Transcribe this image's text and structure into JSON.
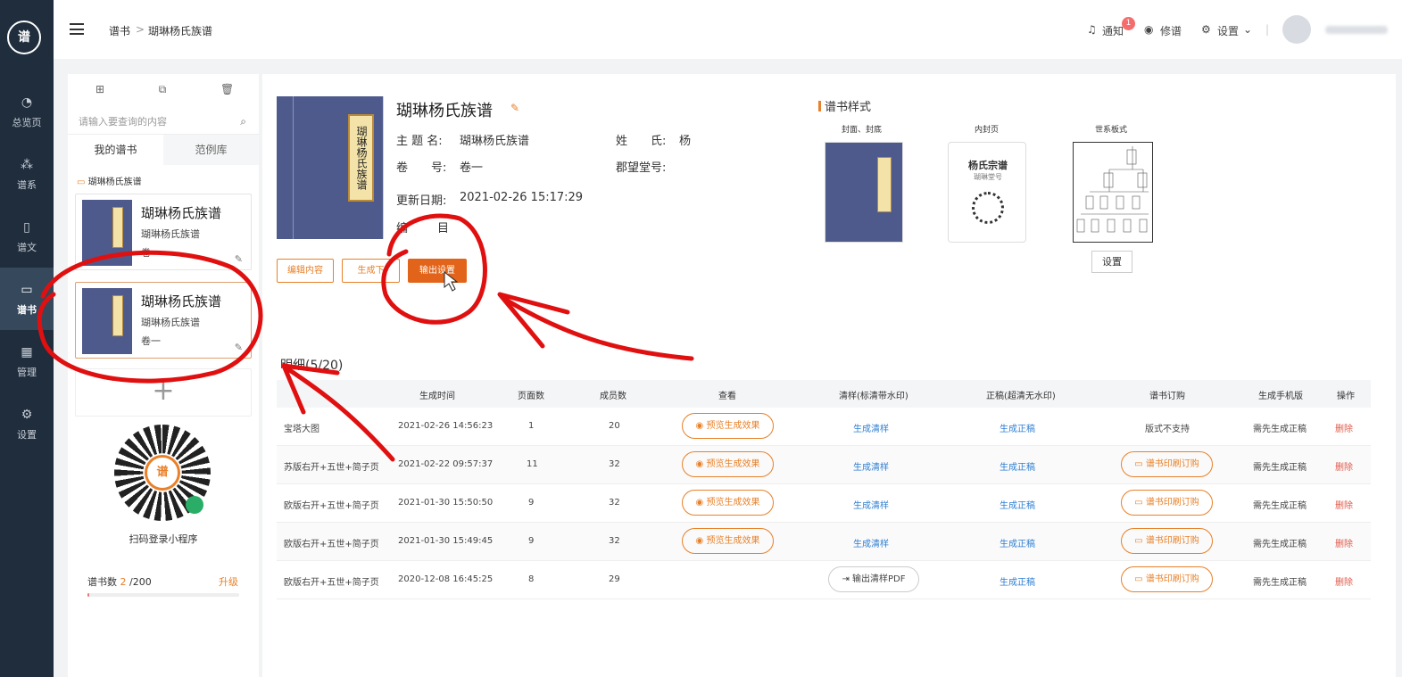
{
  "nav": [
    {
      "label": "总览页",
      "icon": "pie-chart-icon"
    },
    {
      "label": "谱系",
      "icon": "tree-icon"
    },
    {
      "label": "谱文",
      "icon": "document-icon"
    },
    {
      "label": "谱书",
      "icon": "book-icon"
    },
    {
      "label": "管理",
      "icon": "grid-icon"
    },
    {
      "label": "设置",
      "icon": "gear-icon"
    }
  ],
  "breadcrumb": {
    "root": "谱书",
    "sep": ">",
    "current": "瑚琳杨氏族谱"
  },
  "topbar": {
    "notify": "通知",
    "badge": "1",
    "edit": "修谱",
    "settings": "设置"
  },
  "left": {
    "search_placeholder": "请输入要查询的内容",
    "tab_mine": "我的谱书",
    "tab_samples": "范例库",
    "folder": "瑚琳杨氏族谱",
    "cards": [
      {
        "title": "瑚琳杨氏族谱",
        "subtitle": "瑚琳杨氏族谱",
        "volume": "卷一"
      },
      {
        "title": "瑚琳杨氏族谱",
        "subtitle": "瑚琳杨氏族谱",
        "volume": "卷一"
      }
    ],
    "add": "+",
    "qr_caption": "扫码登录小程序",
    "qr_logo": "谱",
    "quota_label": "谱书数",
    "quota_used": "2",
    "quota_total": " /200",
    "quota_fraction": 0.01,
    "upgrade": "升级"
  },
  "book": {
    "cover_label": "瑚琳杨氏族谱",
    "title": "瑚琳杨氏族谱",
    "name_label": "主 题 名:",
    "name": "瑚琳杨氏族谱",
    "surname_label": "姓　　氏:",
    "surname": "杨",
    "vol_label": "卷　　号:",
    "vol": "卷一",
    "hall_label": "郡望堂号:",
    "hall": "",
    "date_label": "更新日期:",
    "date": "2021-02-26 15:17:29",
    "extra_label": "编",
    "extra": "目",
    "btn_edit": "编辑内容",
    "btn_gen": "生成下",
    "btn_export": "输出设置"
  },
  "style": {
    "title": "谱书样式",
    "cover": "封面、封底",
    "inner": "内封页",
    "chart": "世系板式",
    "inner_title": "杨氏宗谱",
    "inner_sub": "瑚琳堂号",
    "setbtn": "设置"
  },
  "table": {
    "title": "明细(5/20)",
    "headers": [
      "生成时间",
      "页面数",
      "成员数",
      "查看",
      "清样(标清带水印)",
      "正稿(超清无水印)",
      "谱书订购",
      "生成手机版",
      "操作"
    ],
    "rows": [
      {
        "name": "宝塔大图",
        "time": "2021-02-26 14:56:23",
        "pages": "1",
        "members": "20",
        "view": "预览生成效果",
        "proof": "生成清样",
        "final": "生成正稿",
        "order": "版式不支持",
        "order_pill": false,
        "mobile": "需先生成正稿",
        "op": "删除"
      },
      {
        "name": "苏版右开+五世+简子页",
        "time": "2021-02-22 09:57:37",
        "pages": "11",
        "members": "32",
        "view": "预览生成效果",
        "proof": "生成清样",
        "final": "生成正稿",
        "order": "谱书印刷订购",
        "order_pill": true,
        "mobile": "需先生成正稿",
        "op": "删除"
      },
      {
        "name": "欧版右开+五世+简子页",
        "time": "2021-01-30 15:50:50",
        "pages": "9",
        "members": "32",
        "view": "预览生成效果",
        "proof": "生成清样",
        "final": "生成正稿",
        "order": "谱书印刷订购",
        "order_pill": true,
        "mobile": "需先生成正稿",
        "op": "删除"
      },
      {
        "name": "欧版右开+五世+简子页",
        "time": "2021-01-30 15:49:45",
        "pages": "9",
        "members": "32",
        "view": "预览生成效果",
        "proof": "生成清样",
        "final": "生成正稿",
        "order": "谱书印刷订购",
        "order_pill": true,
        "mobile": "需先生成正稿",
        "op": "删除"
      },
      {
        "name": "欧版右开+五世+简子页",
        "time": "2020-12-08 16:45:25",
        "pages": "8",
        "members": "29",
        "view": "",
        "proof": "输出清样PDF",
        "final": "生成正稿",
        "order": "谱书印刷订购",
        "order_pill": true,
        "mobile": "需先生成正稿",
        "op": "删除"
      }
    ]
  },
  "colors": {
    "accent": "#e8812a",
    "annotation": "#e01010",
    "sidebar": "#1f2d3d",
    "link": "#2f7fd1"
  }
}
